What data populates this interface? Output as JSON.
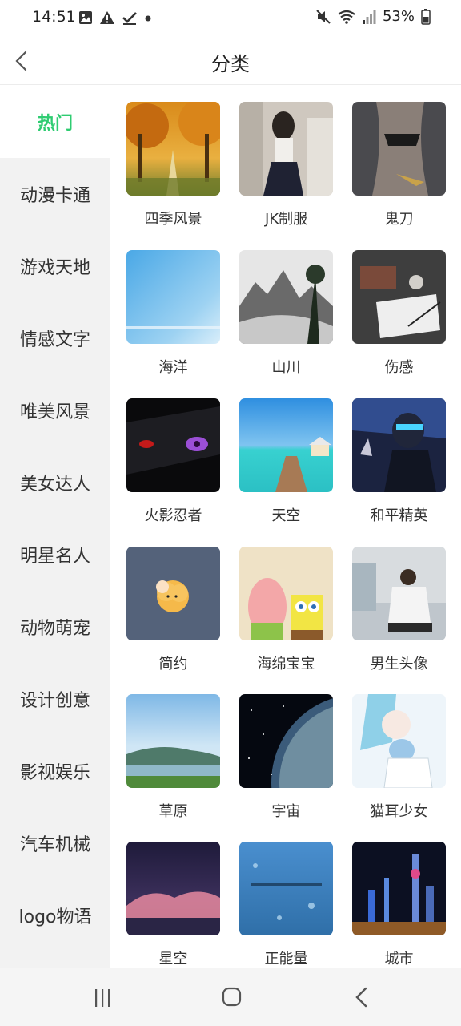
{
  "status_bar": {
    "time": "14:51",
    "battery": "53%",
    "icons": [
      "image-icon",
      "warning-icon",
      "check-icon",
      "dot-icon",
      "mute-icon",
      "wifi-icon",
      "signal-icon",
      "battery-icon"
    ]
  },
  "header": {
    "title": "分类",
    "back_icon": "chevron-left-icon"
  },
  "sidebar": {
    "active_color": "#2ecc71",
    "items": [
      {
        "label": "热门",
        "active": true
      },
      {
        "label": "动漫卡通",
        "active": false
      },
      {
        "label": "游戏天地",
        "active": false
      },
      {
        "label": "情感文字",
        "active": false
      },
      {
        "label": "唯美风景",
        "active": false
      },
      {
        "label": "美女达人",
        "active": false
      },
      {
        "label": "明星名人",
        "active": false
      },
      {
        "label": "动物萌宠",
        "active": false
      },
      {
        "label": "设计创意",
        "active": false
      },
      {
        "label": "影视娱乐",
        "active": false
      },
      {
        "label": "汽车机械",
        "active": false
      },
      {
        "label": "logo物语",
        "active": false
      }
    ]
  },
  "categories": [
    {
      "label": "四季风景"
    },
    {
      "label": "JK制服"
    },
    {
      "label": "鬼刀"
    },
    {
      "label": "海洋"
    },
    {
      "label": "山川"
    },
    {
      "label": "伤感"
    },
    {
      "label": "火影忍者"
    },
    {
      "label": "天空"
    },
    {
      "label": "和平精英"
    },
    {
      "label": "简约"
    },
    {
      "label": "海绵宝宝"
    },
    {
      "label": "男生头像"
    },
    {
      "label": "草原"
    },
    {
      "label": "宇宙"
    },
    {
      "label": "猫耳少女"
    },
    {
      "label": "星空"
    },
    {
      "label": "正能量"
    },
    {
      "label": "城市"
    }
  ],
  "nav_bar": {
    "icons": [
      "recent-apps-icon",
      "home-icon",
      "back-icon"
    ]
  }
}
